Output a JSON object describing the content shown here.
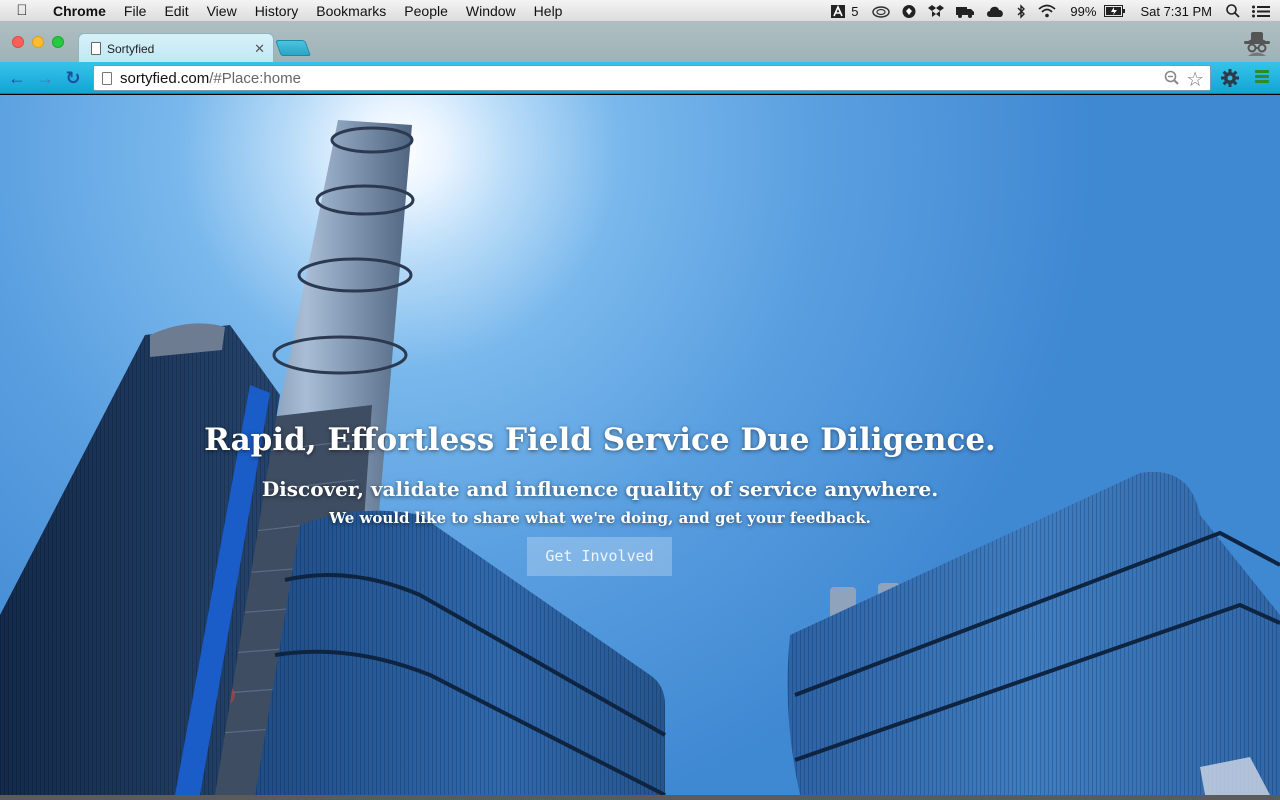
{
  "menubar": {
    "apple_icon": "apple-icon",
    "items": [
      "Chrome",
      "File",
      "Edit",
      "View",
      "History",
      "Bookmarks",
      "People",
      "Window",
      "Help"
    ],
    "status": {
      "adobe_count": "5",
      "battery": "99%",
      "clock": "Sat 7:31 PM"
    }
  },
  "browser": {
    "tab_title": "Sortyfied",
    "url_host": "sortyfied.com",
    "url_path": "/#Place:home",
    "accent_color": "#1bb0dd"
  },
  "hero": {
    "title": "Rapid, Effortless Field Service Due Diligence.",
    "subtitle": "Discover, validate and influence quality of service anywhere.",
    "tagline": "We would like to share what we're doing, and get your feedback.",
    "cta_label": "Get Involved"
  }
}
